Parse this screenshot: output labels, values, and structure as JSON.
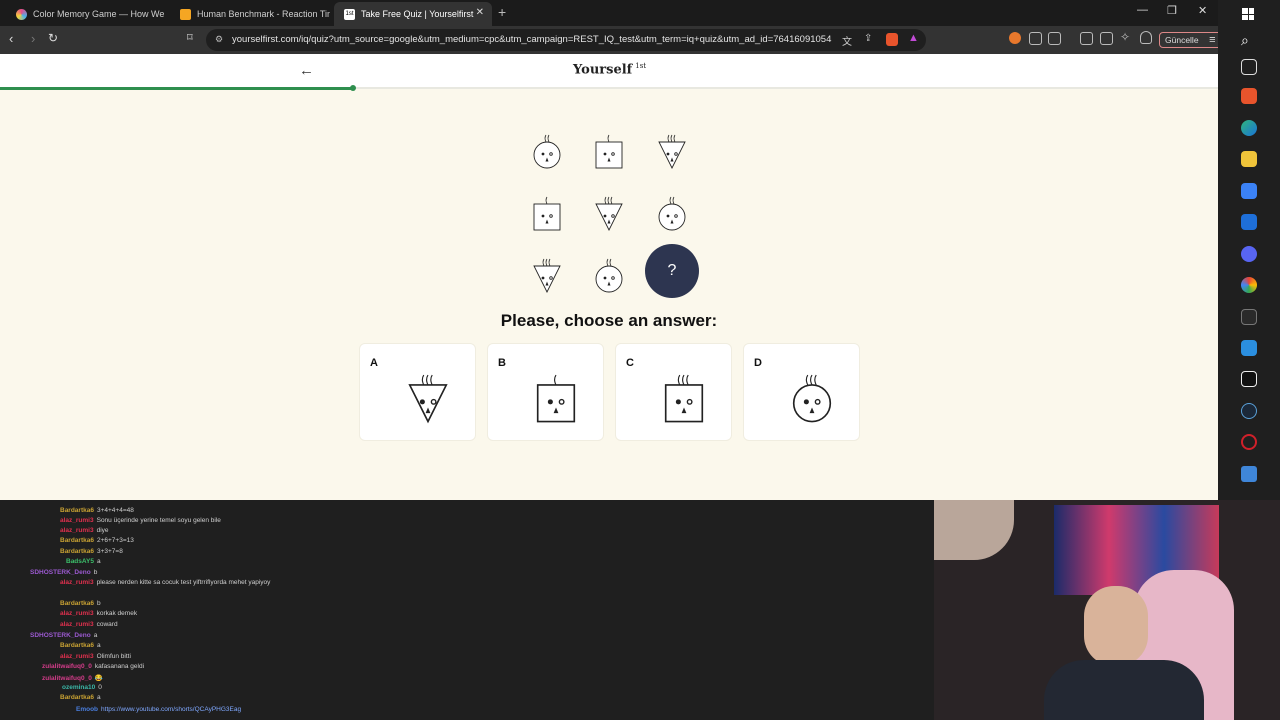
{
  "tabs": [
    {
      "title": "Color Memory Game — How Well Ca",
      "active": false,
      "color": "#e84b8a"
    },
    {
      "title": "Human Benchmark - Reaction Time T",
      "active": false,
      "color": "#f5a623"
    },
    {
      "title": "Take Free Quiz | Yourselfirst",
      "active": true,
      "color": "#ffffff",
      "badge": "1st"
    }
  ],
  "toolbar": {
    "url": "yourselfirst.com/iq/quiz?utm_source=google&utm_medium=cpc&utm_campaign=REST_IQ_test&utm_term=iq+quiz&utm_ad_id=76416091054...",
    "update_label": "Güncelle"
  },
  "site": {
    "brand": "Yourself",
    "brand_sup": "1st",
    "progress_fraction": 0.29
  },
  "question": {
    "grid": [
      [
        "circle",
        "square",
        "triangle"
      ],
      [
        "square",
        "triangle",
        "circle"
      ],
      [
        "triangle",
        "circle",
        "?"
      ]
    ],
    "prompt": "Please, choose an answer:"
  },
  "answers": [
    {
      "letter": "A",
      "shape": "triangle"
    },
    {
      "letter": "B",
      "shape": "square"
    },
    {
      "letter": "C",
      "shape": "square"
    },
    {
      "letter": "D",
      "shape": "circle"
    }
  ],
  "chat": [
    {
      "user": "Bardartka6",
      "msg": "3+4+4+4=48",
      "color": "#c9a233"
    },
    {
      "user": "alaz_rumi3",
      "msg": "Sonu üçerinde yerine temel soyu gelen bile",
      "color": "#e0304e"
    },
    {
      "user": "alaz_rumi3",
      "msg": "diye",
      "color": "#e0304e"
    },
    {
      "user": "Bardartka6",
      "msg": "2+6+7+3=13",
      "color": "#c9a233"
    },
    {
      "user": "Bardartka6",
      "msg": "3+3+7=8",
      "color": "#c9a233"
    },
    {
      "user": "BadsAY5",
      "msg": "a",
      "color": "#3cbf6a"
    },
    {
      "user": "SDHOSTERK_Deno",
      "msg": "b",
      "color": "#9b59d0"
    },
    {
      "user": "alaz_rumi3",
      "msg": "please nerden kitte sa cocuk test yiftrriflyorda mehet yapiyoy",
      "color": "#e0304e"
    },
    {
      "user": "Bardartka6",
      "msg": "b",
      "color": "#c9a233"
    },
    {
      "user": "alaz_rumi3",
      "msg": "korkak demek",
      "color": "#e0304e"
    },
    {
      "user": "alaz_rumi3",
      "msg": "coward",
      "color": "#e0304e"
    },
    {
      "user": "SDHOSTERK_Deno",
      "msg": "a",
      "color": "#9b59d0"
    },
    {
      "user": "Bardartka6",
      "msg": "a",
      "color": "#c9a233"
    },
    {
      "user": "alaz_rumi3",
      "msg": "Olimfun bitti",
      "color": "#e0304e"
    },
    {
      "user": "zulalitwaifuq0_0",
      "msg": "kafasanana geldi",
      "color": "#d43c8a"
    },
    {
      "user": "zulalitwaifuq0_0",
      "msg": "😂",
      "color": "#d43c8a"
    },
    {
      "user": "ozemina10",
      "msg": "0",
      "color": "#3bb7a8"
    },
    {
      "user": "Bardartka6",
      "msg": "a",
      "color": "#c9a233"
    },
    {
      "user": "Emoob",
      "msg": "https://www.youtube.com/shorts/QCAyPHG3Eag",
      "color": "#4a7fe0",
      "msg_color": "#7fa8ff"
    }
  ]
}
